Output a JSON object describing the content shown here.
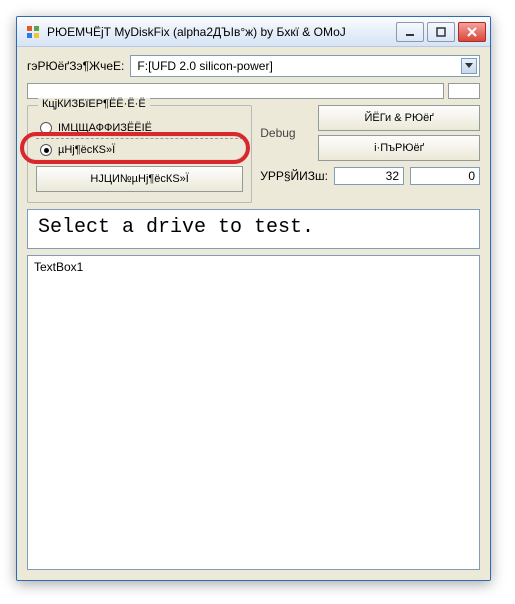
{
  "window": {
    "title": "РЮЕМЧЁјТ MyDiskFix (alpha2ДЪІв°ж) by Бхкї & ОМоЈ"
  },
  "drive": {
    "label": "гэРЮёґЗэ¶ЖчеЕ:",
    "selected": "F:[UFD 2.0 silicon-power]"
  },
  "group": {
    "legend": "КцјКИЗБїЕР¶ЁЁ·Ё·Ё",
    "radio1": "ІМЦЩАФФИЗЁЁІЁ",
    "radio2": "µНј¶ёсКЅ»Ї",
    "button": "НЈЦИ№µНј¶ёсКЅ»Ї"
  },
  "right": {
    "debug": "Debug",
    "btn1": "ЙЁГи & РЮёґ",
    "btn2": "і·ПъРЮёґ"
  },
  "stats": {
    "label": "УРР§ЙИЗш:",
    "box1": "32",
    "box2": "0"
  },
  "status": "Select a drive to test.",
  "textbox": "TextBox1"
}
